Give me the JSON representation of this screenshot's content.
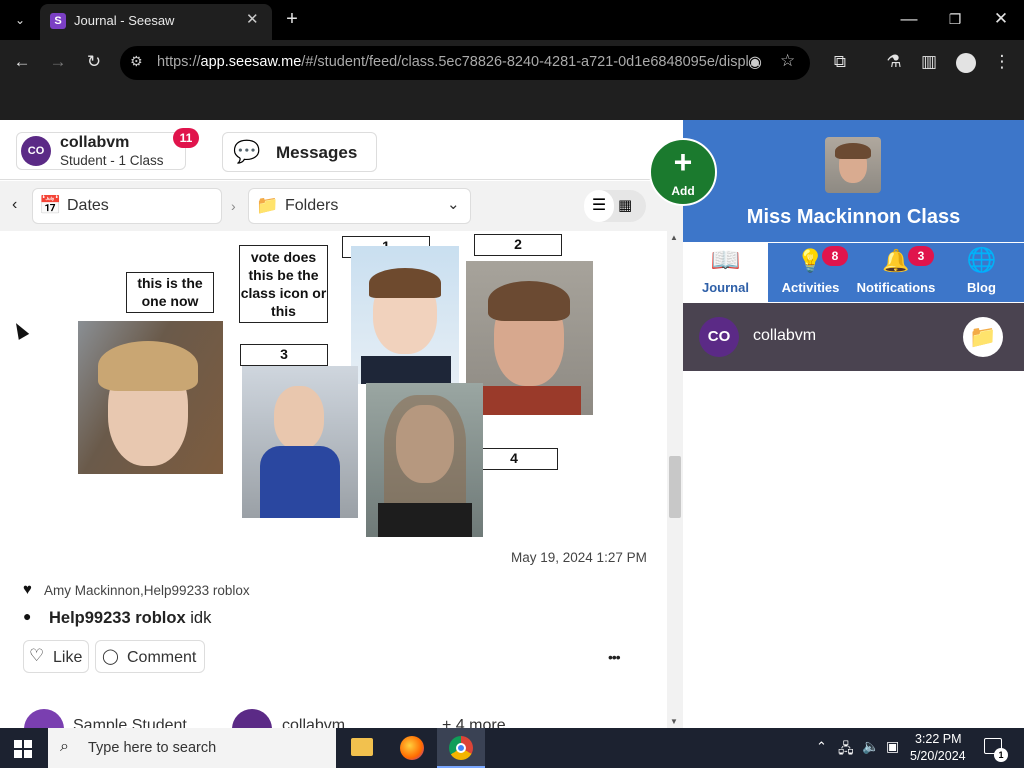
{
  "browser": {
    "tab_title": "Journal - Seesaw",
    "url_prefix": "https://",
    "url_host": "app.seesaw.me",
    "url_path": "/#/student/feed/class.5ec78826-8240-4281-a721-0d1e6848095e/displ..."
  },
  "header": {
    "user_initials": "CO",
    "user_name": "collabvm",
    "user_sub": "Student - 1 Class",
    "badge_count": "11",
    "messages_label": "Messages",
    "add_label": "Add"
  },
  "filters": {
    "dates_label": "Dates",
    "folders_label": "Folders"
  },
  "post": {
    "labels": {
      "current": "this is the one now",
      "vote": "vote does this be the class icon or this",
      "one": "1",
      "two": "2",
      "three": "3",
      "four": "4"
    },
    "timestamp": "May 19, 2024 1:27 PM",
    "likes": "Amy Mackinnon,Help99233 roblox",
    "comment_author": "Help99233 roblox",
    "comment_text": "idk",
    "like_label": "Like",
    "comment_label": "Comment",
    "more_label": "•••"
  },
  "next_post": {
    "name1": "Sample Student",
    "name2": "collabvm",
    "more": "+ 4 more"
  },
  "class_panel": {
    "class_name": "Miss Mackinnon Class",
    "tabs": [
      {
        "label": "Journal",
        "badge": ""
      },
      {
        "label": "Activities",
        "badge": "8"
      },
      {
        "label": "Notifications",
        "badge": "3"
      },
      {
        "label": "Blog",
        "badge": ""
      }
    ],
    "student_initials": "CO",
    "student_name": "collabvm"
  },
  "taskbar": {
    "search_placeholder": "Type here to search",
    "time": "3:22 PM",
    "date": "5/20/2024",
    "notif_count": "1"
  },
  "colors": {
    "brand_blue": "#3d76c9",
    "brand_dark_blue": "#2f60a8",
    "add_green": "#1b7a2e",
    "badge_red": "#e0144c",
    "avatar_purple": "#5b2a86",
    "student_row": "#4a4350"
  }
}
